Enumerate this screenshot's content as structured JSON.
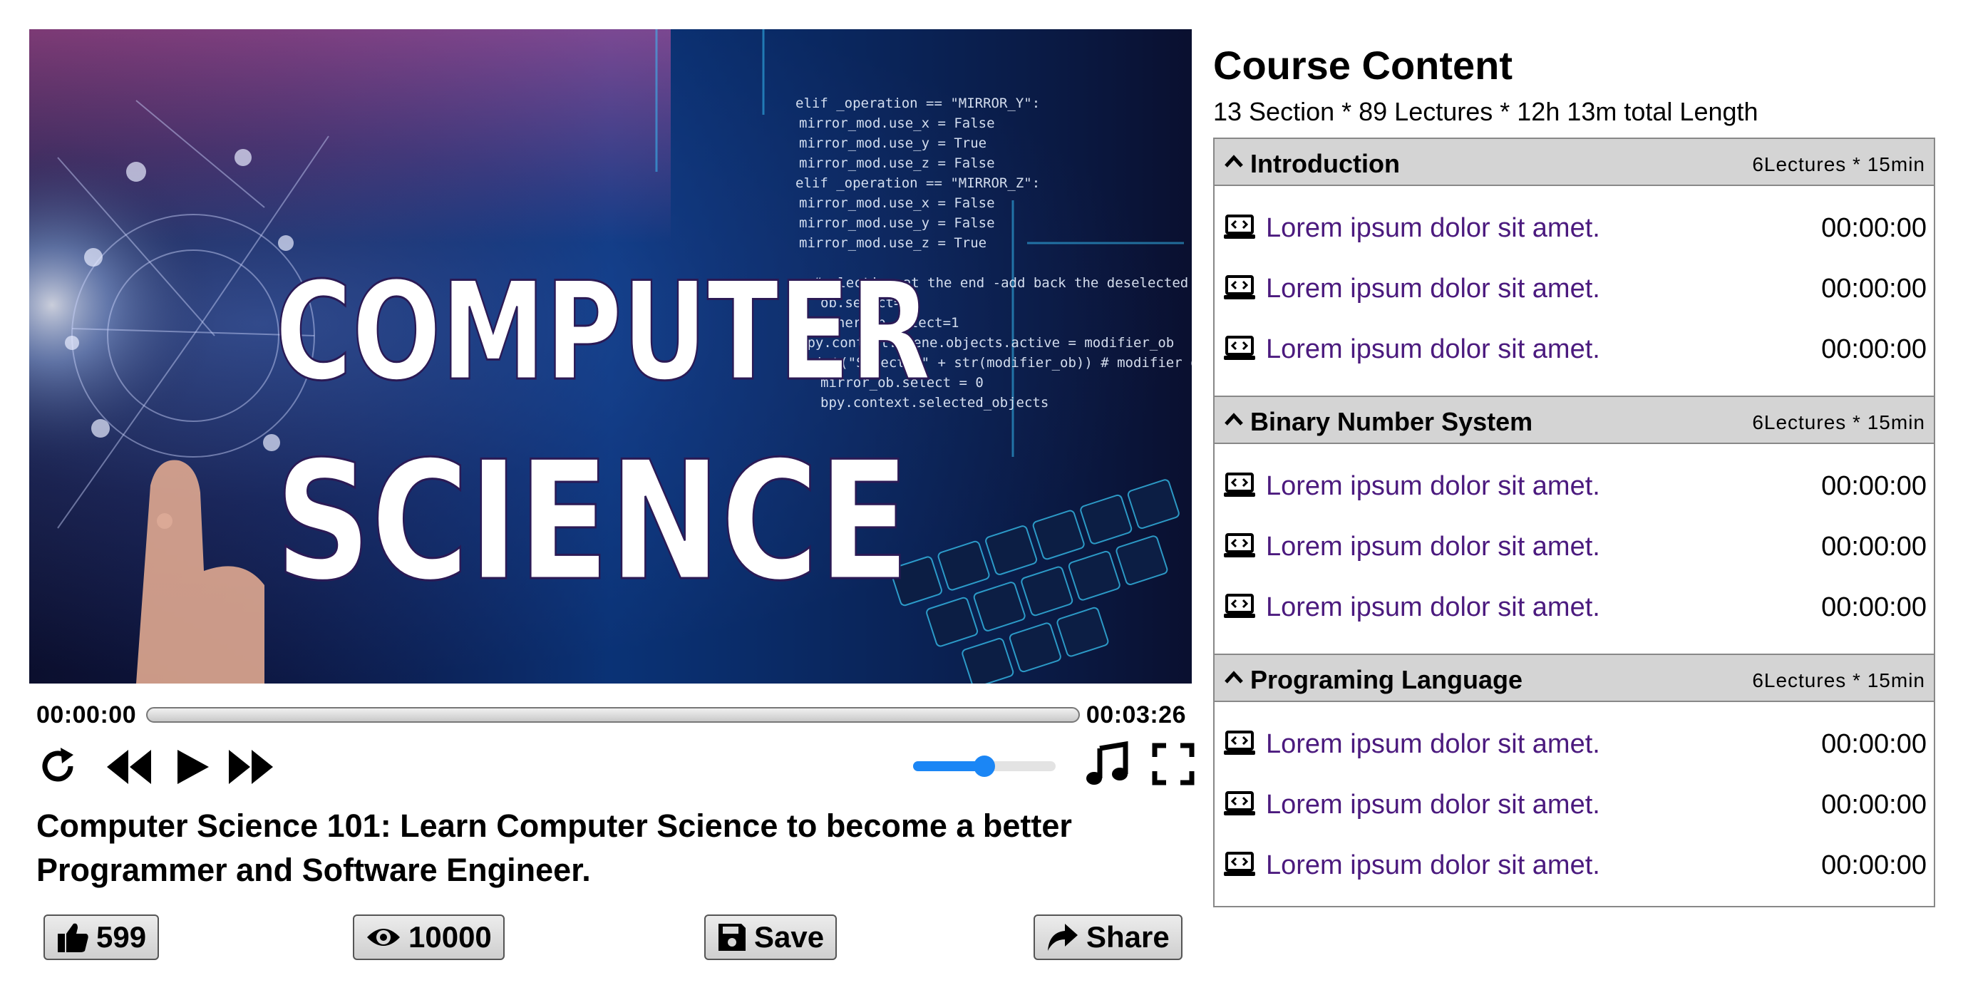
{
  "player": {
    "video": {
      "title_line1": "COMPUTER",
      "title_line2": "SCIENCE",
      "code_lines": [
        "elif _operation == \"MIRROR_Y\":",
        "mirror_mod.use_x = False",
        "mirror_mod.use_y = True",
        "mirror_mod.use_z = False",
        "elif _operation == \"MIRROR_Z\":",
        "mirror_mod.use_x = False",
        "mirror_mod.use_y = False",
        "mirror_mod.use_z = True",
        "",
        "#selection at the end -add back the deselected mirror modifier",
        "ob.select= 1",
        "other_ob.select=1",
        "bpy.context.scene.objects.active = modifier_ob",
        "print(\"Selected\" + str(modifier_ob)) # modifier ob is the active",
        "mirror_ob.select = 0",
        "bpy.context.selected_objects"
      ]
    },
    "current_time": "00:00:00",
    "total_time": "00:03:26",
    "progress": 0.0,
    "volume": 0.5,
    "title": "Computer Science 101: Learn Computer Science to become a better Programmer and Software Engineer.",
    "actions": {
      "like_count": "599",
      "view_count": "10000",
      "save_label": "Save",
      "share_label": "Share"
    }
  },
  "course": {
    "heading": "Course Content",
    "summary": "13 Section * 89 Lectures * 12h 13m total Length",
    "sections": [
      {
        "title": "Introduction",
        "meta": "6Lectures * 15min",
        "lectures": [
          {
            "title": "Lorem ipsum dolor sit amet.",
            "time": "00:00:00"
          },
          {
            "title": "Lorem ipsum dolor sit amet.",
            "time": "00:00:00"
          },
          {
            "title": "Lorem ipsum dolor sit amet.",
            "time": "00:00:00"
          }
        ]
      },
      {
        "title": "Binary Number System",
        "meta": "6Lectures * 15min",
        "lectures": [
          {
            "title": "Lorem ipsum dolor sit amet.",
            "time": "00:00:00"
          },
          {
            "title": "Lorem ipsum dolor sit amet.",
            "time": "00:00:00"
          },
          {
            "title": "Lorem ipsum dolor sit amet.",
            "time": "00:00:00"
          }
        ]
      },
      {
        "title": "Programing Language",
        "meta": "6Lectures * 15min",
        "lectures": [
          {
            "title": "Lorem ipsum dolor sit amet.",
            "time": "00:00:00"
          },
          {
            "title": "Lorem ipsum dolor sit amet.",
            "time": "00:00:00"
          },
          {
            "title": "Lorem ipsum dolor sit amet.",
            "time": "00:00:00"
          }
        ]
      }
    ]
  },
  "colors": {
    "accent": "#1b86f5",
    "lecture_link": "#4b1a7e",
    "section_header_bg": "#d4d4d4"
  }
}
